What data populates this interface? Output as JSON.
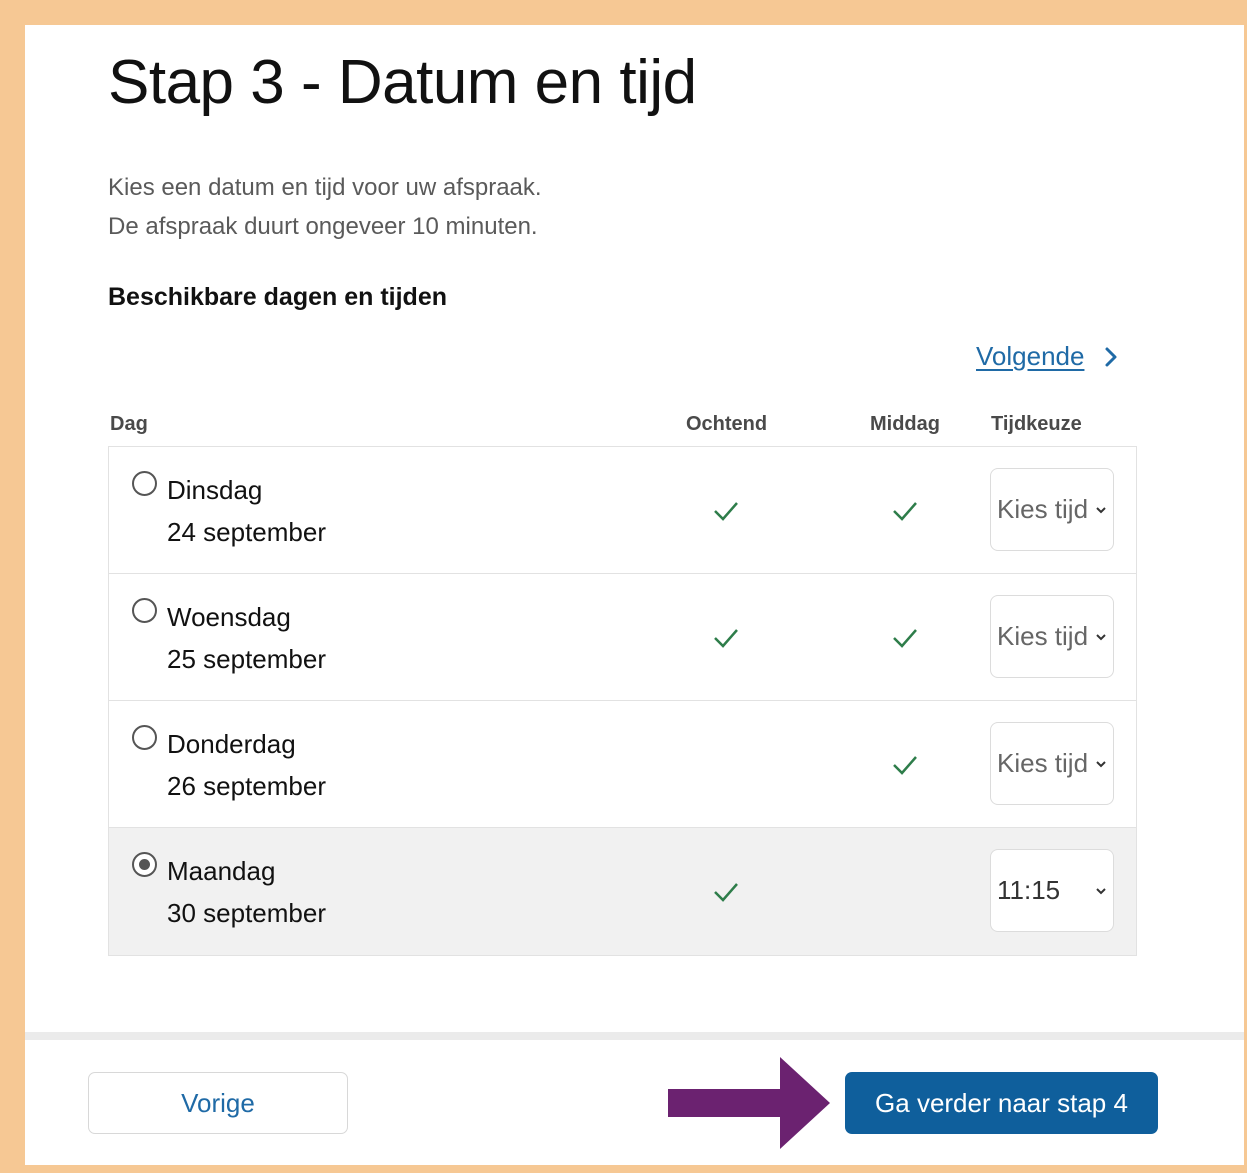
{
  "page": {
    "title": "Stap 3 - Datum en tijd",
    "intro_line1": "Kies een datum en tijd voor uw afspraak.",
    "intro_line2": "De afspraak duurt ongeveer 10 minuten.",
    "section_title": "Beschikbare dagen en tijden",
    "next_link": "Volgende"
  },
  "table": {
    "headers": {
      "day": "Dag",
      "morning": "Ochtend",
      "afternoon": "Middag",
      "time_choice": "Tijdkeuze"
    },
    "rows": [
      {
        "day": "Dinsdag",
        "date": "24 september",
        "morning": true,
        "afternoon": true,
        "time": "Kies tijd",
        "selected": false
      },
      {
        "day": "Woensdag",
        "date": "25 september",
        "morning": true,
        "afternoon": true,
        "time": "Kies tijd",
        "selected": false
      },
      {
        "day": "Donderdag",
        "date": "26 september",
        "morning": false,
        "afternoon": true,
        "time": "Kies tijd",
        "selected": false
      },
      {
        "day": "Maandag",
        "date": "30 september",
        "morning": true,
        "afternoon": false,
        "time": "11:15",
        "selected": true
      }
    ]
  },
  "footer": {
    "prev_label": "Vorige",
    "next_label": "Ga verder naar stap 4"
  },
  "colors": {
    "frame": "#f6c894",
    "link": "#1f6aa6",
    "primary_button": "#0f5f9c",
    "check": "#2e7d4a",
    "arrow": "#6b2270"
  },
  "icons": {
    "next_link_icon": "chevron-right-icon",
    "available_icon": "checkmark-icon",
    "select_icon": "chevron-down-icon",
    "callout": "arrow-right-icon"
  }
}
